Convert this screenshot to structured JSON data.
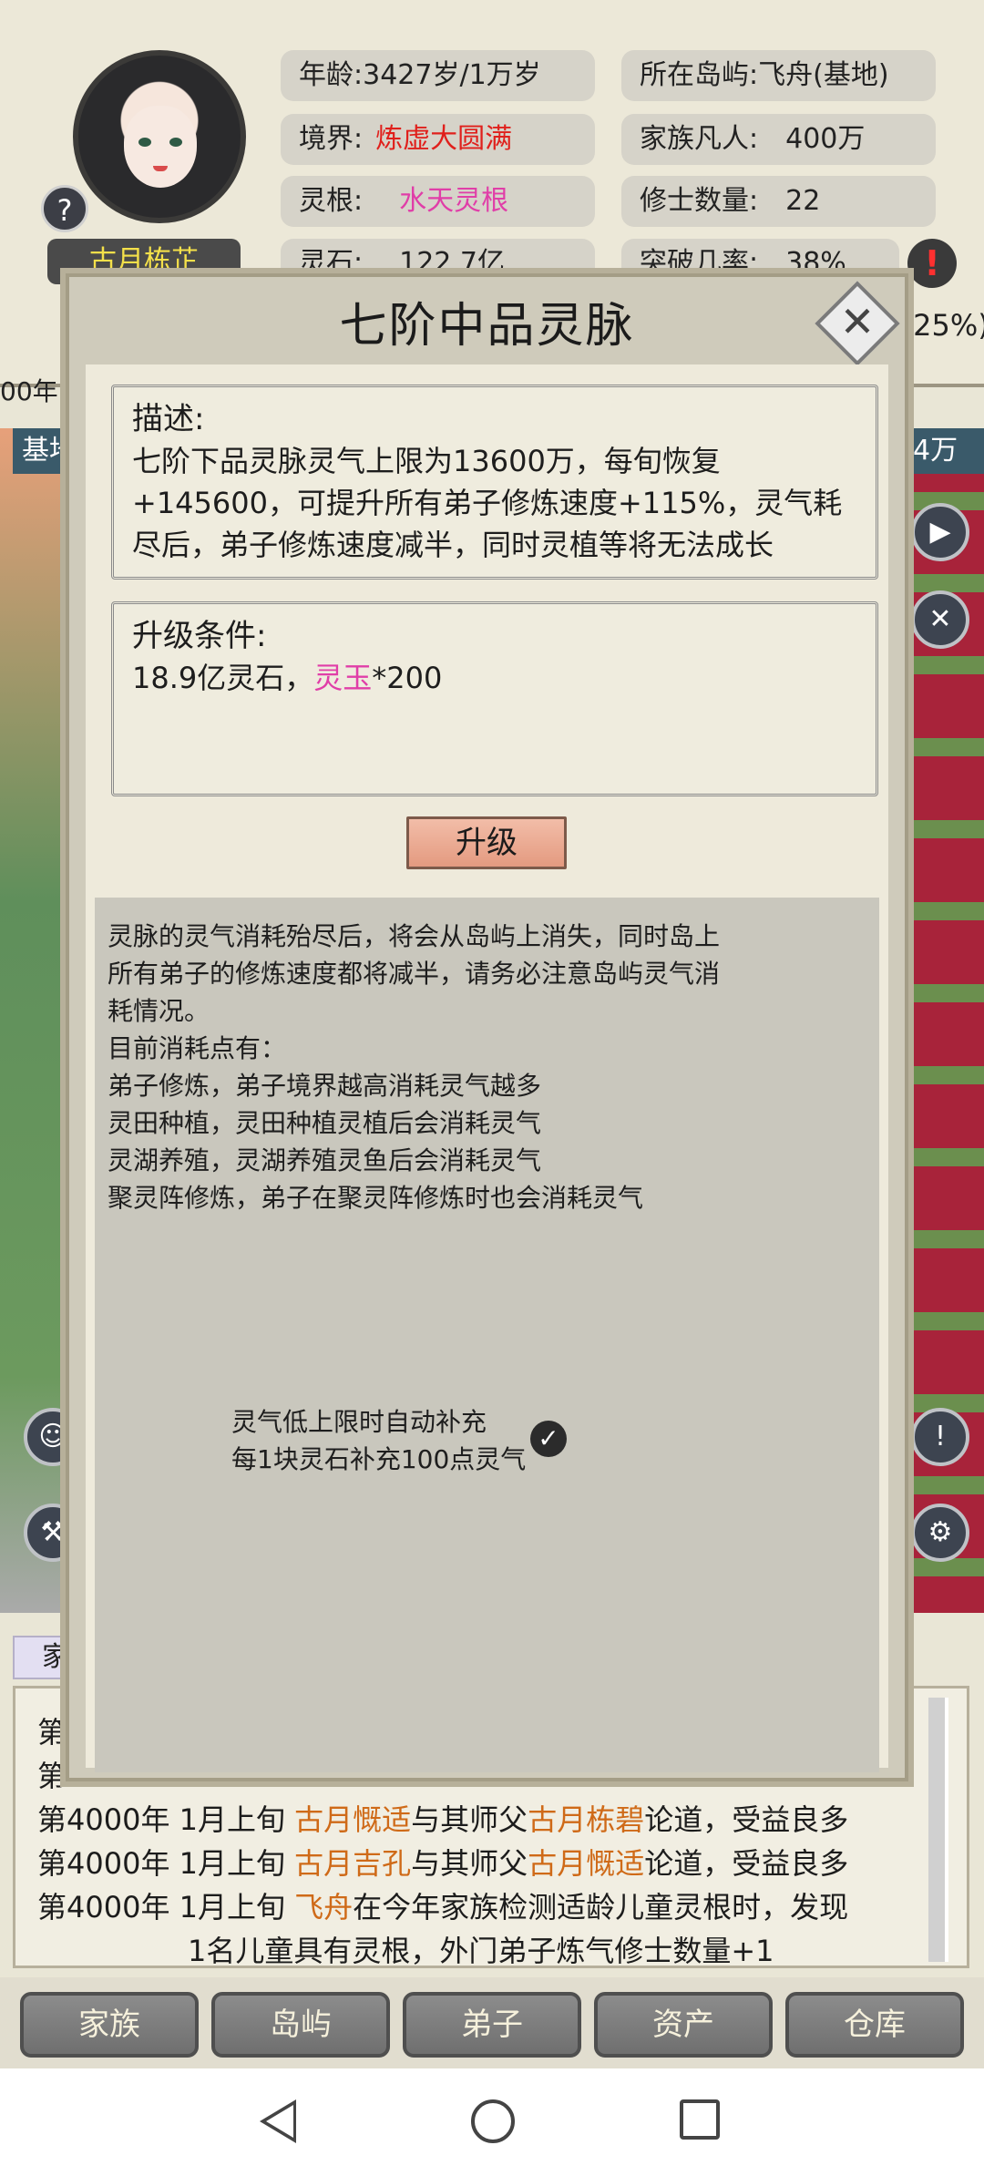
{
  "player": {
    "name": "古月栋芷",
    "age_label": "年龄:",
    "age_value": "3427岁/1万岁",
    "realm_label": "境界:",
    "realm_value": "炼虚大圆满",
    "root_label": "灵根:",
    "root_value": "水天灵根",
    "stone_label": "灵石:",
    "stone_value": "122.7亿",
    "island_label": "所在岛屿:",
    "island_value": "飞舟(基地)",
    "mortals_label": "家族凡人:",
    "mortals_value": "400万",
    "cultivators_label": "修士数量:",
    "cultivators_value": "22",
    "breakthrough_label": "突破几率:",
    "breakthrough_value": "38%",
    "partial_right": ".25%)",
    "partial_year": "00年",
    "partial_base": "基地",
    "partial_right2": "4万"
  },
  "modal": {
    "title": "七阶中品灵脉",
    "close_symbol": "✕",
    "desc_head": "描述:",
    "desc_body": "七阶下品灵脉灵气上限为13600万，每旬恢复+145600，可提升所有弟子修炼速度+115%，灵气耗尽后，弟子修炼速度减半，同时灵植等将无法成长",
    "upgrade_head": "升级条件:",
    "upgrade_cost_prefix": "18.9亿灵石，",
    "upgrade_item": "灵玉",
    "upgrade_item_qty": "*200",
    "upgrade_button": "升级",
    "info_lines": [
      "灵脉的灵气消耗殆尽后，将会从岛屿上消失，同时岛上",
      "所有弟子的修炼速度都将减半，请务必注意岛屿灵气消",
      "耗情况。",
      "目前消耗点有：",
      "弟子修炼，弟子境界越高消耗灵气越多",
      "灵田种植，灵田种植灵植后会消耗灵气",
      "灵湖养殖，灵湖养殖灵鱼后会消耗灵气",
      "聚灵阵修炼，弟子在聚灵阵修炼时也会消耗灵气"
    ],
    "auto_line1": "灵气低上限时自动补充",
    "auto_line2": "每1块灵石补充100点灵气",
    "auto_checked": true
  },
  "log": {
    "row1_prefix": "第",
    "row2_prefix": "第",
    "row3": {
      "date": "第4000年 1月上旬 ",
      "a": "古月慨适",
      "mid": "与其师父",
      "b": "古月栋碧",
      "end": "论道，受益良多"
    },
    "row4": {
      "date": "第4000年 1月上旬 ",
      "a": "古月吉孔",
      "mid": "与其师父",
      "b": "古月慨适",
      "end": "论道，受益良多"
    },
    "row5": {
      "date": "第4000年 1月上旬 ",
      "a": "飞舟",
      "end": "在今年家族检测适龄儿童灵根时，发现"
    },
    "row6": "1名儿童具有灵根，外门弟子炼气修士数量+1",
    "tab_partial": "家"
  },
  "nav": {
    "items": [
      "家族",
      "岛屿",
      "弟子",
      "资产",
      "仓库"
    ]
  },
  "colors": {
    "realm_red": "#e0201c",
    "root_pink": "#e03ea8",
    "log_orange": "#cf6a18",
    "name_yellow": "#f4e04a"
  }
}
